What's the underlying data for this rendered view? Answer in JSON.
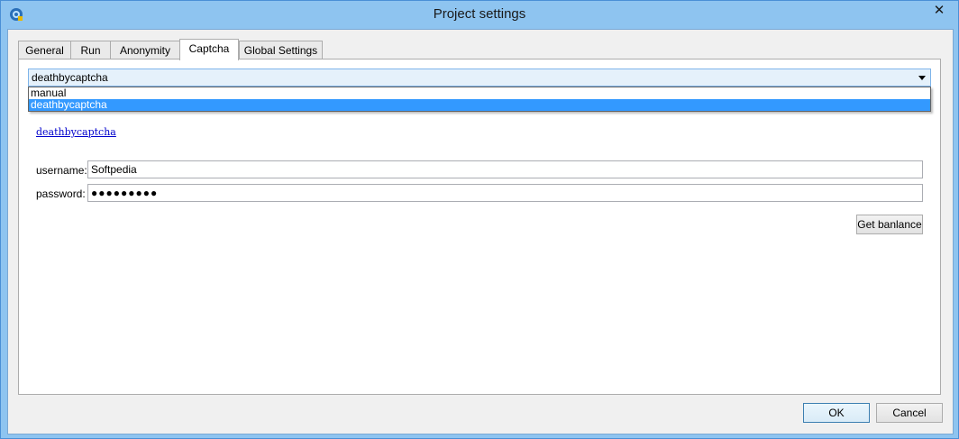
{
  "window": {
    "title": "Project settings",
    "close_glyph": "✕"
  },
  "tabs": [
    {
      "label": "General"
    },
    {
      "label": "Run"
    },
    {
      "label": "Anonymity"
    },
    {
      "label": "Captcha"
    },
    {
      "label": "Global Settings"
    }
  ],
  "captcha": {
    "service_selected": "deathbycaptcha",
    "service_options": [
      "manual",
      "deathbycaptcha"
    ],
    "service_link": "deathbycaptcha",
    "username_label": "username:",
    "username_value": "Softpedia",
    "password_label": "password:",
    "password_value": "●●●●●●●●●",
    "balance_button": "Get banlance"
  },
  "footer": {
    "ok_label": "OK",
    "cancel_label": "Cancel"
  },
  "colors": {
    "titlebar": "#8ec4f0",
    "selection": "#3399ff",
    "link": "#0000cc"
  }
}
